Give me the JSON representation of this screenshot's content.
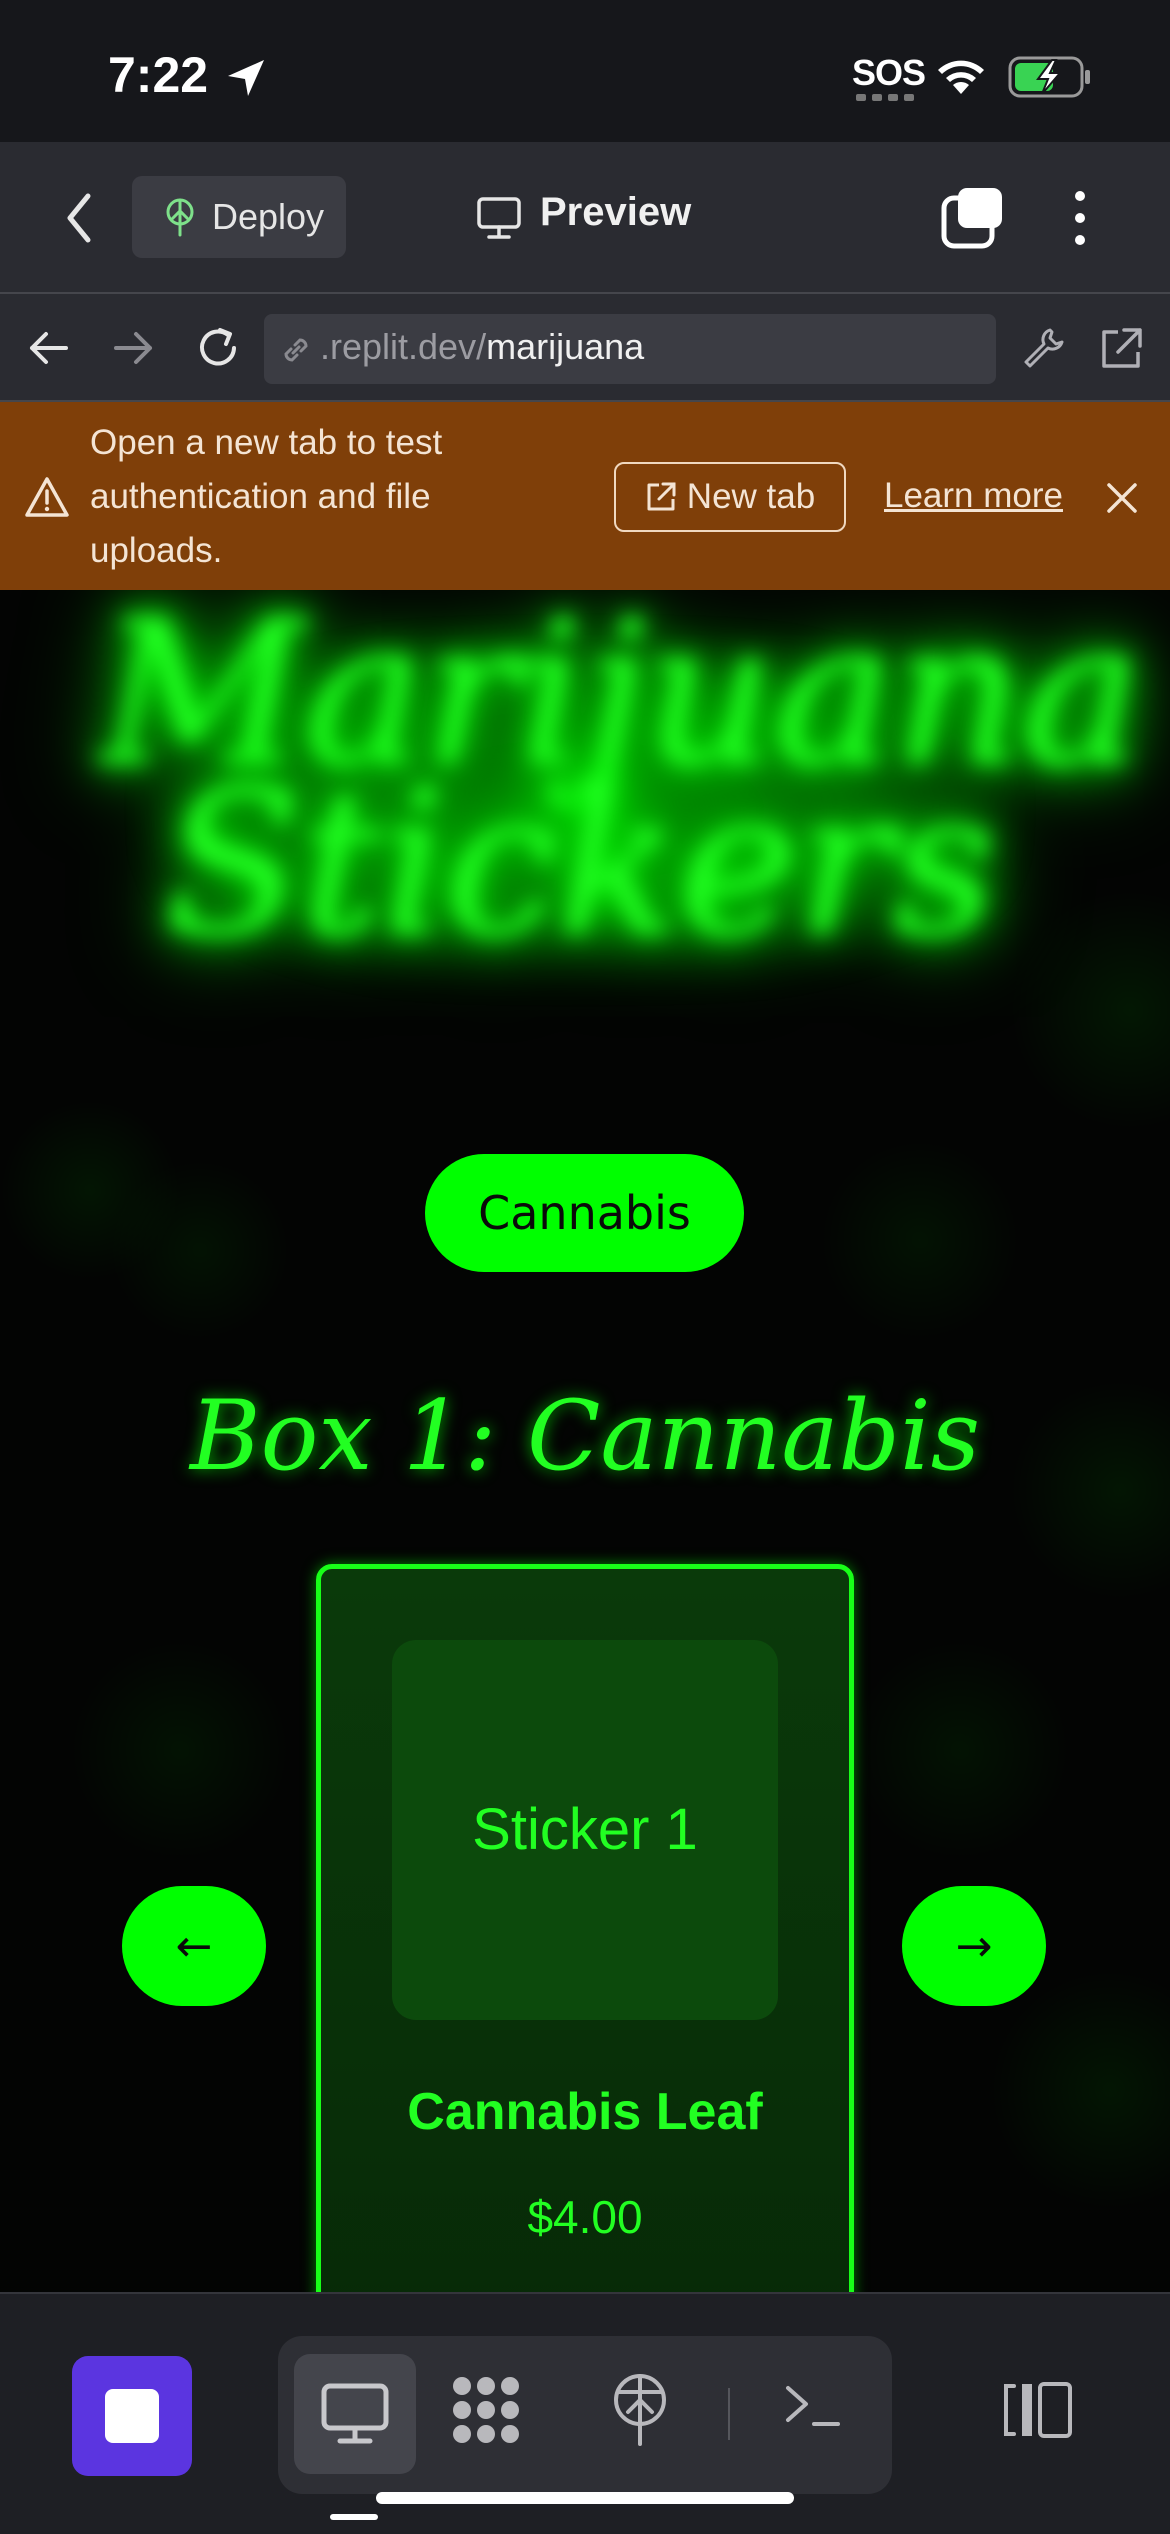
{
  "status_bar": {
    "time": "7:22",
    "sos": "SOS"
  },
  "toolbar": {
    "deploy_label": "Deploy",
    "title": "Preview"
  },
  "url_bar": {
    "host": ".replit.dev/",
    "path": "marijuana"
  },
  "banner": {
    "message": "Open a new tab to test authentication and file uploads.",
    "new_tab_label": "New tab",
    "learn_more_label": "Learn more",
    "background": "#7f3f09"
  },
  "page": {
    "hero_title": "Marijuana Stickers",
    "category_label": "Cannabis",
    "box_title": "Box 1: Cannabis",
    "prev_label": "←",
    "next_label": "→",
    "product": {
      "sticker_label": "Sticker 1",
      "name": "Cannabis Leaf",
      "price": "$4.00"
    },
    "accent": "#00ff00"
  },
  "bottom_bar": {
    "stop_color": "#5b35e0"
  }
}
